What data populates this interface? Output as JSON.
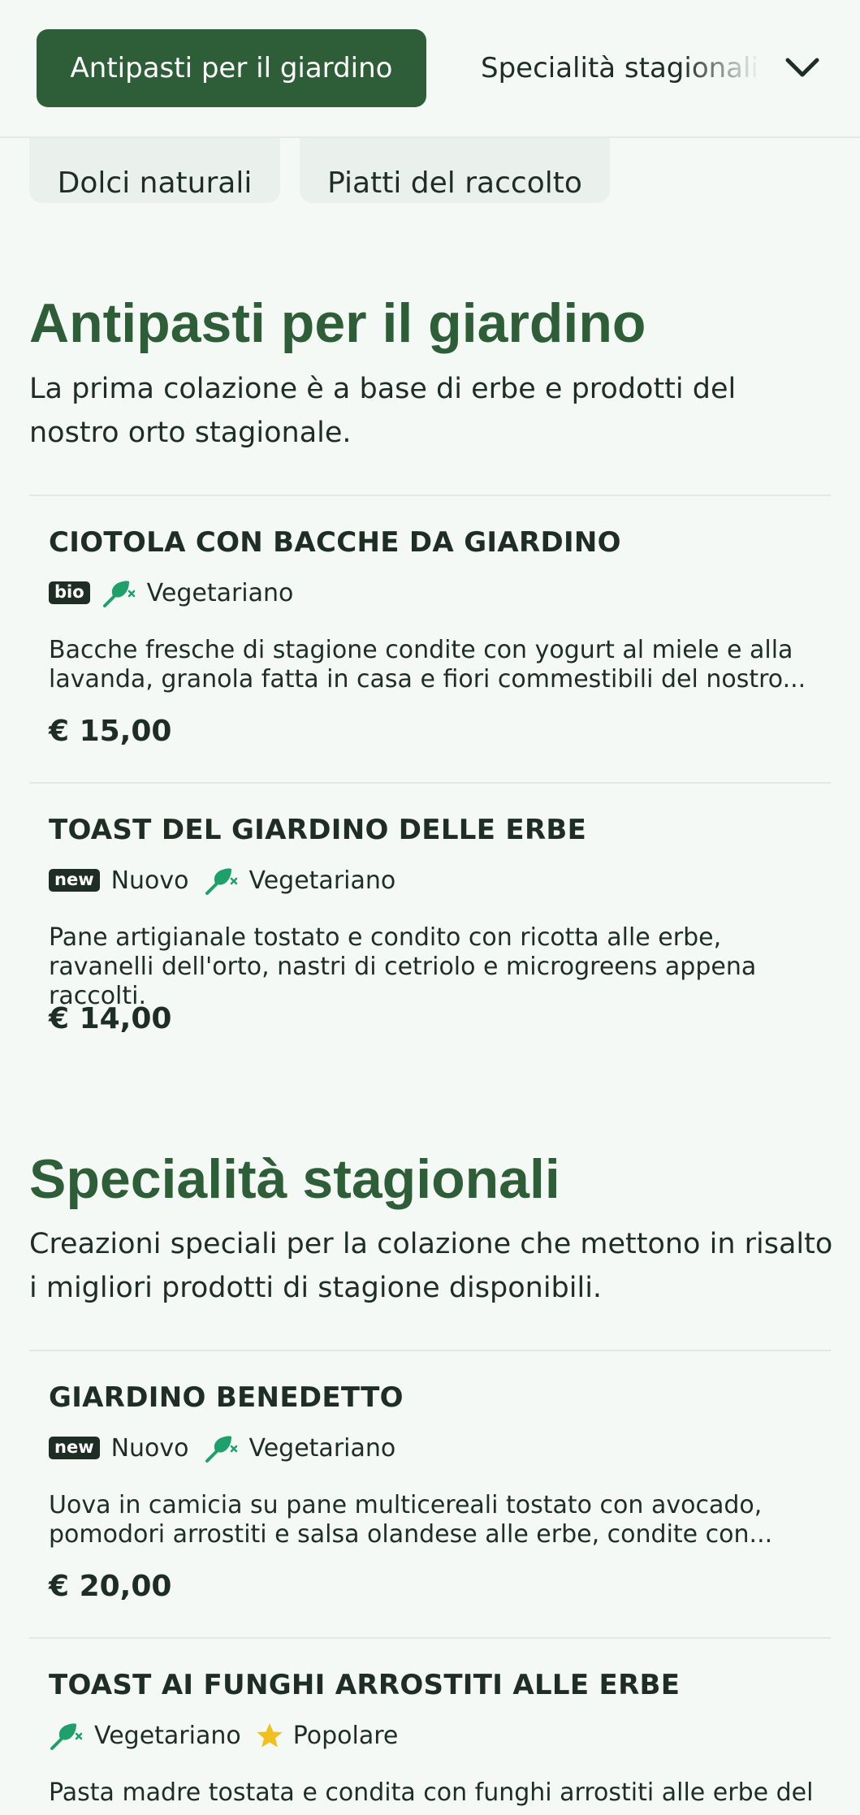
{
  "category_nav": {
    "active_label": "Antipasti per il giardino",
    "next_label": "Specialità stagionali",
    "chips": [
      "Dolci naturali",
      "Piatti del raccolto"
    ]
  },
  "sections": [
    {
      "title": "Antipasti per il giardino",
      "description": "La prima colazione è a base di erbe e prodotti del nostro orto stagionale.",
      "items": [
        {
          "name": "CIOTOLA CON BACCHE DA GIARDINO",
          "badge": "bio",
          "tag_vegetarian": "Vegetariano",
          "description": "Bacche fresche di stagione condite con yogurt al miele e alla lavanda, granola fatta in casa e fiori commestibili del nostro...",
          "price": "€ 15,00"
        },
        {
          "name": "TOAST DEL GIARDINO DELLE ERBE",
          "badge": "new",
          "badge_label": "Nuovo",
          "tag_vegetarian": "Vegetariano",
          "description": "Pane artigianale tostato e condito con ricotta alle erbe, ravanelli dell'orto, nastri di cetriolo e microgreens appena raccolti.",
          "price": "€ 14,00"
        }
      ]
    },
    {
      "title": "Specialità stagionali",
      "description": "Creazioni speciali per la colazione che mettono in risalto i migliori prodotti di stagione disponibili.",
      "items": [
        {
          "name": "GIARDINO BENEDETTO",
          "badge": "new",
          "badge_label": "Nuovo",
          "tag_vegetarian": "Vegetariano",
          "description": "Uova in camicia su pane multicereali tostato con avocado, pomodori arrostiti e salsa olandese alle erbe, condite con...",
          "price": "€ 20,00"
        },
        {
          "name": "TOAST AI FUNGHI ARROSTITI ALLE ERBE",
          "tag_vegetarian": "Vegetariano",
          "tag_popular": "Popolare",
          "description": "Pasta madre tostata e condita con funghi arrostiti alle erbe del"
        }
      ]
    }
  ],
  "colors": {
    "brand_green": "#2e5e37",
    "background": "#f5f9f5",
    "text": "#1f2e24",
    "leaf_icon": "#1fa06b",
    "star_icon": "#f2c01e"
  },
  "icons": [
    "chevron-down-icon",
    "vegetarian-leaf-icon",
    "star-icon"
  ]
}
